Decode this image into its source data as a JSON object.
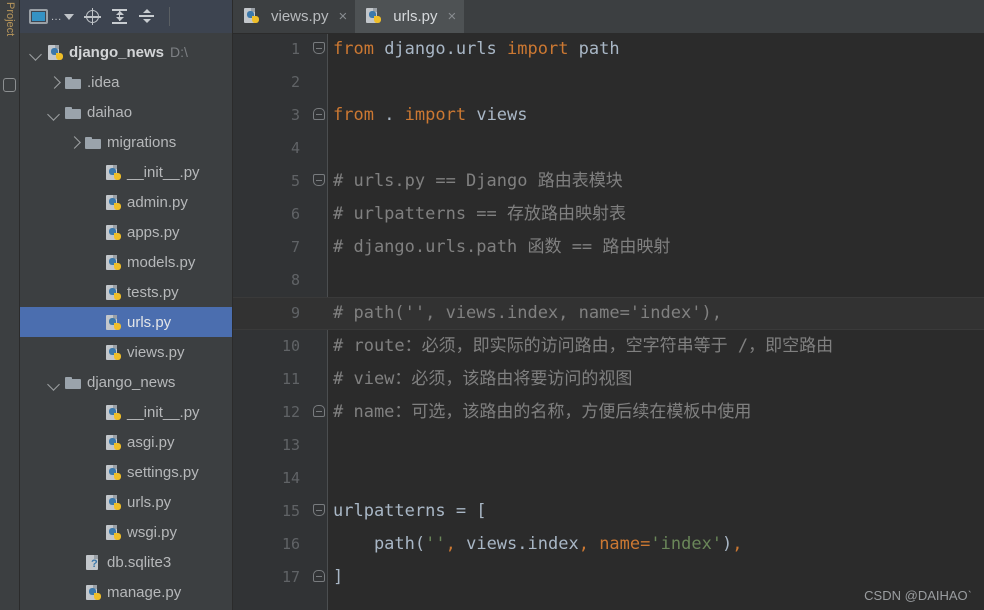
{
  "left_strip": {
    "vertical_label": "Project",
    "structure_icon": "structure-icon"
  },
  "project_panel": {
    "toolbar": {
      "view_selector_label": "...",
      "view_selector_icon": "window-icon",
      "locate_icon": "target-icon",
      "expand_all_icon": "expand-all-icon",
      "collapse_all_icon": "collapse-all-icon"
    },
    "tree": [
      {
        "label": "django_news",
        "path": "D:\\",
        "icon": "python-project-icon",
        "arrow": "down",
        "indent": 0,
        "bold": true,
        "selected": false
      },
      {
        "label": ".idea",
        "path": "",
        "icon": "folder-icon",
        "arrow": "right",
        "indent": 1,
        "bold": false,
        "selected": false
      },
      {
        "label": "daihao",
        "path": "",
        "icon": "folder-icon",
        "arrow": "down",
        "indent": 1,
        "bold": false,
        "selected": false
      },
      {
        "label": "migrations",
        "path": "",
        "icon": "folder-icon",
        "arrow": "right",
        "indent": 2,
        "bold": false,
        "selected": false
      },
      {
        "label": "__init__.py",
        "path": "",
        "icon": "python-file-icon",
        "arrow": "none",
        "indent": 3,
        "bold": false,
        "selected": false
      },
      {
        "label": "admin.py",
        "path": "",
        "icon": "python-file-icon",
        "arrow": "none",
        "indent": 3,
        "bold": false,
        "selected": false
      },
      {
        "label": "apps.py",
        "path": "",
        "icon": "python-file-icon",
        "arrow": "none",
        "indent": 3,
        "bold": false,
        "selected": false
      },
      {
        "label": "models.py",
        "path": "",
        "icon": "python-file-icon",
        "arrow": "none",
        "indent": 3,
        "bold": false,
        "selected": false
      },
      {
        "label": "tests.py",
        "path": "",
        "icon": "python-file-icon",
        "arrow": "none",
        "indent": 3,
        "bold": false,
        "selected": false
      },
      {
        "label": "urls.py",
        "path": "",
        "icon": "python-file-icon",
        "arrow": "none",
        "indent": 3,
        "bold": false,
        "selected": true
      },
      {
        "label": "views.py",
        "path": "",
        "icon": "python-file-icon",
        "arrow": "none",
        "indent": 3,
        "bold": false,
        "selected": false
      },
      {
        "label": "django_news",
        "path": "",
        "icon": "folder-icon",
        "arrow": "down",
        "indent": 1,
        "bold": false,
        "selected": false
      },
      {
        "label": "__init__.py",
        "path": "",
        "icon": "python-file-icon",
        "arrow": "none",
        "indent": 3,
        "bold": false,
        "selected": false
      },
      {
        "label": "asgi.py",
        "path": "",
        "icon": "python-file-icon",
        "arrow": "none",
        "indent": 3,
        "bold": false,
        "selected": false
      },
      {
        "label": "settings.py",
        "path": "",
        "icon": "python-file-icon",
        "arrow": "none",
        "indent": 3,
        "bold": false,
        "selected": false
      },
      {
        "label": "urls.py",
        "path": "",
        "icon": "python-file-icon",
        "arrow": "none",
        "indent": 3,
        "bold": false,
        "selected": false
      },
      {
        "label": "wsgi.py",
        "path": "",
        "icon": "python-file-icon",
        "arrow": "none",
        "indent": 3,
        "bold": false,
        "selected": false
      },
      {
        "label": "db.sqlite3",
        "path": "",
        "icon": "unknown-file-icon",
        "arrow": "none",
        "indent": 2,
        "bold": false,
        "selected": false
      },
      {
        "label": "manage.py",
        "path": "",
        "icon": "python-file-icon",
        "arrow": "none",
        "indent": 2,
        "bold": false,
        "selected": false
      }
    ]
  },
  "editor": {
    "tabs": [
      {
        "label": "views.py",
        "active": false,
        "close_label": "×"
      },
      {
        "label": "urls.py",
        "active": true,
        "close_label": "×"
      }
    ],
    "current_line": 9,
    "lines": [
      {
        "n": "1",
        "fold": "minus",
        "tokens": [
          {
            "t": "from",
            "c": "kw"
          },
          {
            "t": " django.urls ",
            "c": "id"
          },
          {
            "t": "import",
            "c": "kw"
          },
          {
            "t": " path",
            "c": "id"
          }
        ]
      },
      {
        "n": "2",
        "fold": "none",
        "tokens": []
      },
      {
        "n": "3",
        "fold": "house",
        "tokens": [
          {
            "t": "from",
            "c": "kw"
          },
          {
            "t": " . ",
            "c": "id"
          },
          {
            "t": "import",
            "c": "kw"
          },
          {
            "t": " views",
            "c": "id"
          }
        ]
      },
      {
        "n": "4",
        "fold": "none",
        "tokens": []
      },
      {
        "n": "5",
        "fold": "minus",
        "tokens": [
          {
            "t": "# urls.py == Django 路由表模块",
            "c": "cm"
          }
        ]
      },
      {
        "n": "6",
        "fold": "none",
        "tokens": [
          {
            "t": "# urlpatterns == 存放路由映射表",
            "c": "cm"
          }
        ]
      },
      {
        "n": "7",
        "fold": "none",
        "tokens": [
          {
            "t": "# django.urls.path 函数 == 路由映射",
            "c": "cm"
          }
        ]
      },
      {
        "n": "8",
        "fold": "none",
        "tokens": []
      },
      {
        "n": "9",
        "fold": "none",
        "tokens": [
          {
            "t": "# path('', views.index, name='index'),",
            "c": "cm"
          }
        ]
      },
      {
        "n": "10",
        "fold": "none",
        "tokens": [
          {
            "t": "# route：必须，即实际的访问路由，空字符串等于 /，即空路由",
            "c": "cm"
          }
        ]
      },
      {
        "n": "11",
        "fold": "none",
        "tokens": [
          {
            "t": "# view：必须，该路由将要访问的视图",
            "c": "cm"
          }
        ]
      },
      {
        "n": "12",
        "fold": "house",
        "tokens": [
          {
            "t": "# name：可选，该路由的名称，方便后续在模板中使用",
            "c": "cm"
          }
        ]
      },
      {
        "n": "13",
        "fold": "none",
        "tokens": []
      },
      {
        "n": "14",
        "fold": "none",
        "tokens": []
      },
      {
        "n": "15",
        "fold": "minus",
        "tokens": [
          {
            "t": "urlpatterns",
            "c": "id"
          },
          {
            "t": " = [",
            "c": "punc"
          }
        ]
      },
      {
        "n": "16",
        "fold": "none",
        "tokens": [
          {
            "t": "    path(",
            "c": "id"
          },
          {
            "t": "''",
            "c": "str"
          },
          {
            "t": ",",
            "c": "comma"
          },
          {
            "t": " views.index",
            "c": "id"
          },
          {
            "t": ",",
            "c": "comma"
          },
          {
            "t": " ",
            "c": "id"
          },
          {
            "t": "name",
            "c": "kw"
          },
          {
            "t": "=",
            "c": "kw"
          },
          {
            "t": "'index'",
            "c": "str"
          },
          {
            "t": ")",
            "c": "id"
          },
          {
            "t": ",",
            "c": "comma"
          }
        ]
      },
      {
        "n": "17",
        "fold": "house",
        "tokens": [
          {
            "t": "]",
            "c": "id"
          }
        ]
      }
    ]
  },
  "watermark": {
    "text": "CSDN @DAIHAOˋ"
  },
  "colors": {
    "editor_bg": "#2b2b2b",
    "gutter_bg": "#313335",
    "panel_bg": "#3c3f41",
    "selection_blue": "#4b6eaf",
    "keyword_orange": "#cc7832",
    "string_green": "#6a8759",
    "identifier": "#a9b7c6",
    "comment_gray": "#808080",
    "current_line": "#323232"
  }
}
